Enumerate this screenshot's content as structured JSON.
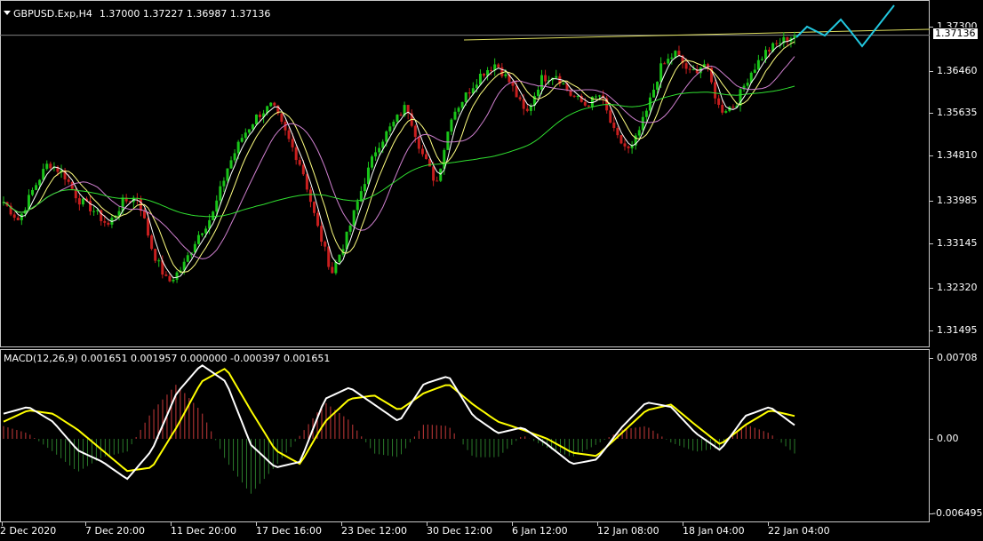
{
  "header": {
    "symbol_label": "GBPUSD.Exp,H4",
    "ohlc": "1.37000 1.37227 1.36987 1.37136"
  },
  "macd": {
    "label": "MACD(12,26,9) 0.001651 0.001957 0.000000 -0.000397 0.001651"
  },
  "price_axis": {
    "current_price": "1.37136",
    "ticks": [
      "1.37300",
      "1.36460",
      "1.35635",
      "1.34810",
      "1.33985",
      "1.33145",
      "1.32320",
      "1.31495"
    ]
  },
  "macd_axis": {
    "ticks": [
      "0.00708",
      "0.00",
      "-0.006495"
    ]
  },
  "time_axis": {
    "labels": [
      "2 Dec 2020",
      "7 Dec 20:00",
      "11 Dec 20:00",
      "17 Dec 16:00",
      "23 Dec 12:00",
      "30 Dec 12:00",
      "6 Jan 12:00",
      "12 Jan 08:00",
      "18 Jan 04:00",
      "22 Jan 04:00"
    ]
  },
  "colors": {
    "bull": "#19c419",
    "bear": "#c81e1e",
    "ma_fast": "#ffffff",
    "ma_mid": "#ffff80",
    "ma_slow": "#d080d0",
    "ma_long": "#30e030",
    "forecast": "#22c8e0",
    "macd_line": "#ffffff",
    "signal_line": "#ffff00",
    "hist_pos": "#c83a3a",
    "hist_neg": "#2a7a2a"
  },
  "chart_data": {
    "type": "candlestick",
    "title": "GBPUSD.Exp,H4",
    "close": [
      1.3395,
      1.336,
      1.342,
      1.347,
      1.345,
      1.34,
      1.338,
      1.335,
      1.3395,
      1.3405,
      1.33,
      1.324,
      1.327,
      1.333,
      1.337,
      1.346,
      1.352,
      1.356,
      1.358,
      1.352,
      1.346,
      1.335,
      1.326,
      1.333,
      1.342,
      1.35,
      1.354,
      1.358,
      1.349,
      1.343,
      1.356,
      1.36,
      1.364,
      1.366,
      1.362,
      1.356,
      1.363,
      1.364,
      1.36,
      1.358,
      1.36,
      1.352,
      1.349,
      1.356,
      1.365,
      1.368,
      1.364,
      1.366,
      1.357,
      1.358,
      1.364,
      1.368,
      1.37,
      1.3714
    ],
    "ylim": [
      1.311,
      1.3745
    ],
    "overlays": [
      "MA fast",
      "MA mid",
      "MA slow",
      "MA long"
    ],
    "macd": [
      0.0022,
      0.0028,
      0.0015,
      -0.001,
      -0.002,
      -0.0035,
      -0.001,
      0.004,
      0.0065,
      0.005,
      -0.0005,
      -0.0025,
      -0.002,
      0.0035,
      0.0045,
      0.003,
      0.0015,
      0.0048,
      0.0055,
      0.002,
      0.0005,
      0.001,
      -0.0005,
      -0.0022,
      -0.0018,
      0.001,
      0.0032,
      0.0028,
      0.0005,
      -0.001,
      0.002,
      0.0028,
      0.0012
    ],
    "signal": [
      0.0015,
      0.0025,
      0.0022,
      0.0008,
      -0.001,
      -0.0028,
      -0.0025,
      0.001,
      0.005,
      0.0062,
      0.0025,
      -0.001,
      -0.0022,
      0.0015,
      0.0035,
      0.0038,
      0.0025,
      0.004,
      0.0048,
      0.003,
      0.0015,
      0.0008,
      0.0,
      -0.0012,
      -0.0015,
      0.0005,
      0.0025,
      0.003,
      0.0012,
      -0.0005,
      0.0012,
      0.0025,
      0.002
    ],
    "macd_ylim": [
      -0.0065,
      0.0071
    ]
  }
}
